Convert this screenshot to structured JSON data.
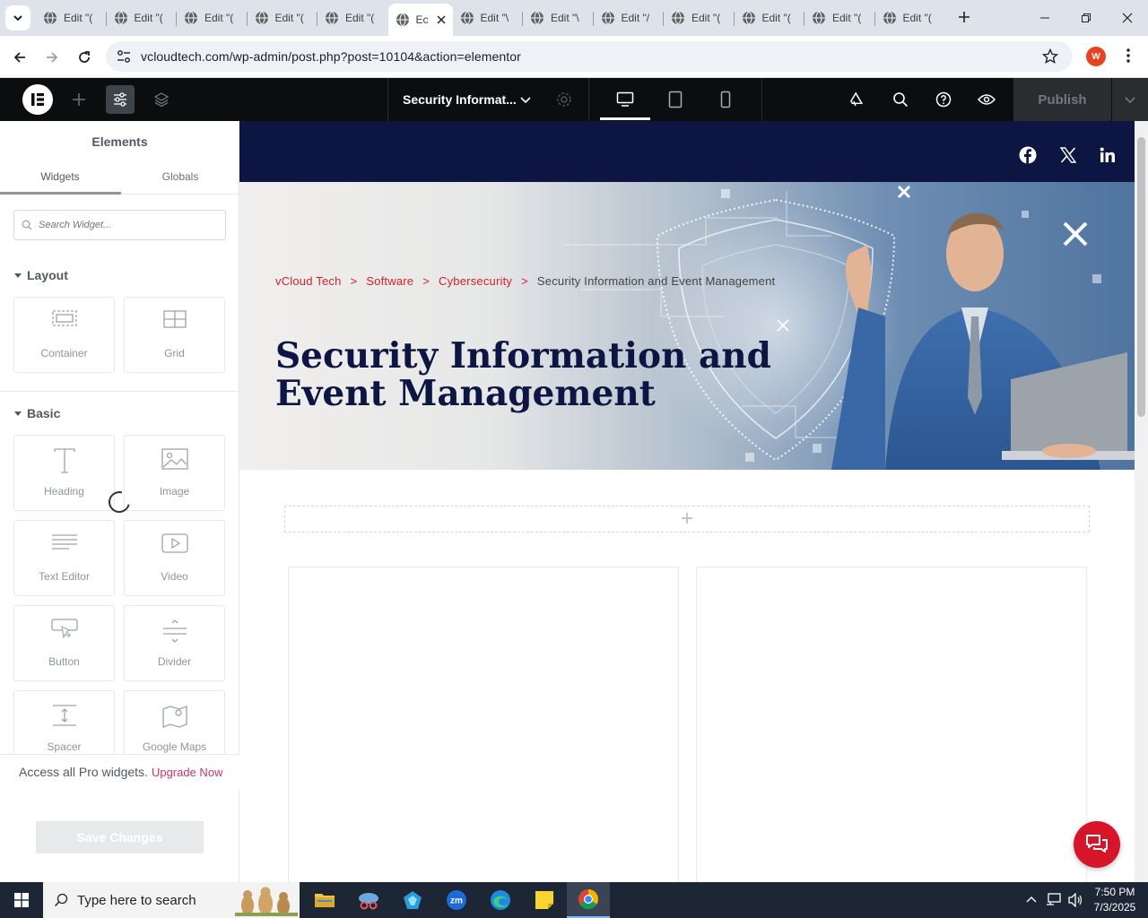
{
  "browser": {
    "tabs": [
      {
        "title": "Edit \"("
      },
      {
        "title": "Edit \"("
      },
      {
        "title": "Edit \"("
      },
      {
        "title": "Edit \"("
      },
      {
        "title": "Edit \"("
      },
      {
        "title": "Ec",
        "active": true
      },
      {
        "title": "Edit \"\\"
      },
      {
        "title": "Edit \"\\"
      },
      {
        "title": "Edit \"/"
      },
      {
        "title": "Edit \"("
      },
      {
        "title": "Edit \"("
      },
      {
        "title": "Edit \"("
      },
      {
        "title": "Edit \"("
      }
    ],
    "url": "vcloudtech.com/wp-admin/post.php?post=10104&action=elementor",
    "profile_initial": "W"
  },
  "editor": {
    "page_title": "Security Informat...",
    "publish_label": "Publish"
  },
  "panel": {
    "title": "Elements",
    "tabs": [
      "Widgets",
      "Globals"
    ],
    "search_placeholder": "Search Widget...",
    "sections": {
      "layout": "Layout",
      "basic": "Basic"
    },
    "layout_widgets": [
      "Container",
      "Grid"
    ],
    "basic_widgets": [
      "Heading",
      "Image",
      "Text Editor",
      "Video",
      "Button",
      "Divider",
      "Spacer",
      "Google Maps"
    ],
    "pro_text": "Access all Pro widgets.",
    "pro_link": "Upgrade Now",
    "save_label": "Save Changes"
  },
  "canvas": {
    "breadcrumb": [
      "vCloud Tech",
      "Software",
      "Cybersecurity"
    ],
    "breadcrumb_current": "Security Information and Event Management",
    "breadcrumb_sep": ">",
    "hero_title": "Security Information and Event Management",
    "add_symbol": "+"
  },
  "taskbar": {
    "search_placeholder": "Type here to search",
    "time": "7:50 PM",
    "date": "7/3/2025"
  },
  "colors": {
    "site_navy": "#0d1543",
    "breadcrumb_red": "#d4202a",
    "elementor_dark": "#0c0d0e",
    "pro_link": "#cc3366",
    "chat_red": "#d7152a"
  }
}
